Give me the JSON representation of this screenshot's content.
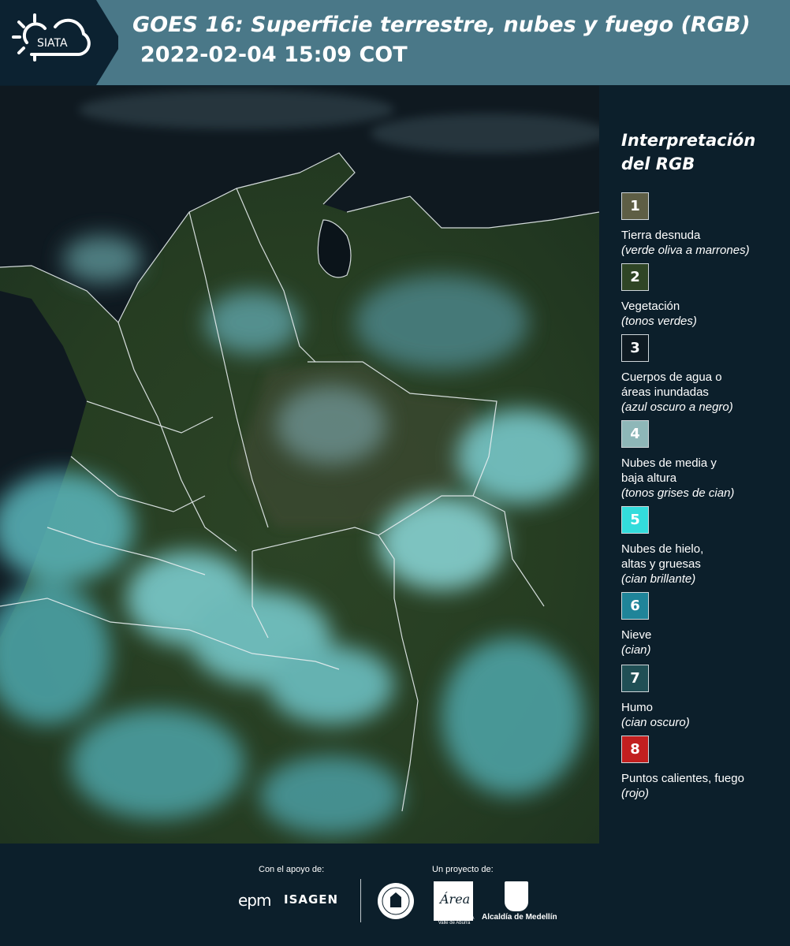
{
  "header": {
    "logo_text": "SIATA",
    "title_line1": "GOES 16: Superficie terrestre, nubes y fuego (RGB)",
    "title_line2": "2022-02-04 15:09 COT"
  },
  "legend": {
    "title": "Interpretación del RGB",
    "items": [
      {
        "number": "1",
        "label": "Tierra desnuda",
        "sub": "(verde oliva a marrones)",
        "color": "#5e5e45"
      },
      {
        "number": "2",
        "label": "Vegetación",
        "sub": "(tonos verdes)",
        "color": "#2f4525"
      },
      {
        "number": "3",
        "label": "Cuerpos de agua o áreas inundadas",
        "sub": "(azul oscuro a negro)",
        "color": "#0e1a22"
      },
      {
        "number": "4",
        "label": "Nubes de media y baja altura",
        "sub": "(tonos grises de cian)",
        "color": "#8eb7b8"
      },
      {
        "number": "5",
        "label": "Nubes de hielo, altas y gruesas",
        "sub": "(cian brillante)",
        "color": "#33dcdc"
      },
      {
        "number": "6",
        "label": "Nieve",
        "sub": "(cian)",
        "color": "#1f8499"
      },
      {
        "number": "7",
        "label": "Humo",
        "sub": "(cian oscuro)",
        "color": "#204f55"
      },
      {
        "number": "8",
        "label": "Puntos calientes, fuego",
        "sub": "(rojo)",
        "color": "#c21f1f"
      }
    ]
  },
  "footer": {
    "support_label": "Con el apoyo de:",
    "project_label": "Un proyecto de:",
    "sponsor1": "epm",
    "sponsor2": "ISAGEN",
    "area_text": "METROPOLITANA Valle de Aburrá",
    "area_logo_text": "Área",
    "medellin_text": "Alcaldía de Medellín"
  }
}
